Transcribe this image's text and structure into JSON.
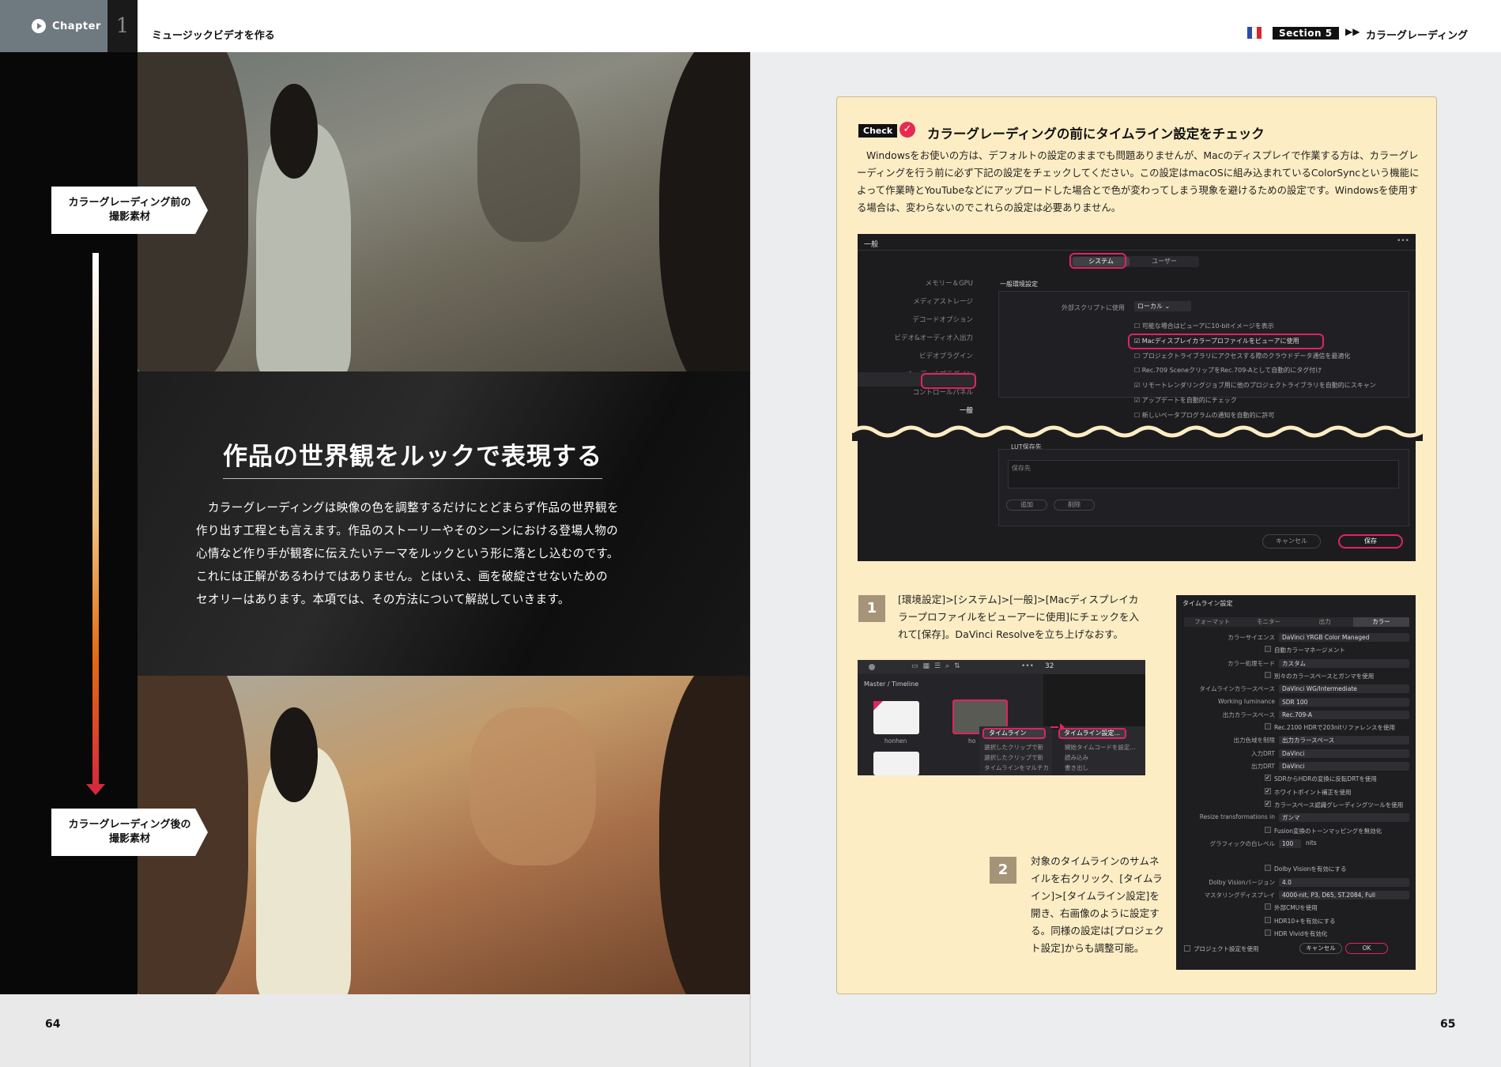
{
  "header": {
    "chapter_label": "Chapter",
    "chapter_number": "1",
    "chapter_title": "ミュージックビデオを作る",
    "section_badge": "Section 5",
    "section_arrows": "▶▶",
    "section_title": "カラーグレーディング",
    "flag_colors": [
      "#2b4da8",
      "#ffffff",
      "#d8262f"
    ]
  },
  "left": {
    "label_before_1": "カラーグレーディング前の",
    "label_before_2": "撮影素材",
    "label_after_1": "カラーグレーディング後の",
    "label_after_2": "撮影素材",
    "main_title": "作品の世界観をルックで表現する",
    "body": [
      "　カラーグレーディングは映像の色を調整するだけにとどまらず作品の世界観を",
      "作り出す工程とも言えます。作品のストーリーやそのシーンにおける登場人物の",
      "心情など作り手が観客に伝えたいテーマをルックという形に落とし込むのです。",
      "これには正解があるわけではありません。とはいえ、画を破綻させないための",
      "セオリーはあります。本項では、その方法について解説していきます。"
    ],
    "page_number": "64"
  },
  "right": {
    "check_tag": "Check",
    "check_mark": "✓",
    "check_title": "カラーグレーディングの前にタイムライン設定をチェック",
    "check_body": "Windowsをお使いの方は、デフォルトの設定のままでも問題ありませんが、Macのディスプレイで作業する方は、カラーグレーディングを行う前に必ず下記の設定をチェックしてください。この設定はmacOSに組み込まれているColorSyncという機能によって作業時とYouTubeなどにアップロードした場合とで色が変わってしまう現象を避けるための設定です。Windowsを使用する場合は、変わらないのでこれらの設定は必要ありません。",
    "shot1": {
      "title": "一般",
      "menu_dots": "•••",
      "tab_system": "システム",
      "tab_user": "ユーザー",
      "sidebar": [
        "メモリー＆GPU",
        "メディアストレージ",
        "デコードオプション",
        "ビデオ&オーディオ入出力",
        "ビデオプラグイン",
        "オーディオプラグイン",
        "コントロールパネル",
        "一般"
      ],
      "section_label": "一般環境設定",
      "script_label": "外部スクリプトに使用",
      "script_value": "ローカル",
      "options": [
        {
          "checked": false,
          "text": "可能な場合はビューアに10-bitイメージを表示"
        },
        {
          "checked": true,
          "text": "Macディスプレイカラープロファイルをビューアに使用"
        },
        {
          "checked": false,
          "text": "プロジェクトライブラリにアクセスする際のクラウドデータ通信を最適化"
        },
        {
          "checked": false,
          "text": "Rec.709 SceneクリップをRec.709-Aとして自動的にタグ付け"
        },
        {
          "checked": true,
          "text": "リモートレンダリングジョブ用に他のプロジェクトライブラリを自動的にスキャン"
        },
        {
          "checked": true,
          "text": "アップデートを自動的にチェック"
        },
        {
          "checked": false,
          "text": "新しいベータプログラムの通知を自動的に許可"
        }
      ],
      "lut_label": "LUT保存先",
      "save_to": "保存先",
      "add": "追加",
      "delete": "削除",
      "cancel": "キャンセル",
      "save": "保存"
    },
    "step1_num": "1",
    "step1_text": "[環境設定]>[システム]>[一般]>[Macディスプレイカラープロファイルをビューアーに使用]にチェックを入れて[保存]。DaVinci Resolveを立ち上げなおす。",
    "shot2": {
      "crumb": "Master / Timeline",
      "zoom": "32",
      "thumb1": "honhen",
      "thumb2": "ho",
      "menu_timeline": "タイムライン",
      "ctx": [
        "選択したクリップで新",
        "選択したクリップで新",
        "タイムラインをマルチカ"
      ],
      "sub": [
        "タイムライン設定...",
        "開始タイムコードを設定...",
        "読み込み",
        "書き出し"
      ]
    },
    "step2_num": "2",
    "step2_text": "対象のタイムラインのサムネイルを右クリック、[タイムライン]>[タイムライン設定]を開き、右画像のように設定する。同様の設定は[プロジェクト設定]からも調整可能。",
    "shot3": {
      "title": "タイムライン設定",
      "tabs": [
        "フォーマット",
        "モニター",
        "出力",
        "カラー"
      ],
      "rows": [
        {
          "label": "カラーサイエンス",
          "value": "DaVinci YRGB Color Managed"
        },
        {
          "check": false,
          "text": "自動カラーマネージメント"
        },
        {
          "label": "カラー処理モード",
          "value": "カスタム"
        },
        {
          "check": false,
          "text": "別々のカラースペースとガンマを使用"
        },
        {
          "label": "タイムラインカラースペース",
          "value": "DaVinci WG/Intermediate"
        },
        {
          "label": "Working luminance",
          "value": "SDR 100"
        },
        {
          "label": "出力カラースペース",
          "value": "Rec.709-A"
        },
        {
          "check": false,
          "text": "Rec.2100 HDRで203nitリファレンスを使用"
        },
        {
          "label": "出力色域を制限",
          "value": "出力カラースペース"
        },
        {
          "label": "入力DRT",
          "value": "DaVinci"
        },
        {
          "label": "出力DRT",
          "value": "DaVinci"
        },
        {
          "check": true,
          "text": "SDRからHDRの変換に反転DRTを使用"
        },
        {
          "check": true,
          "text": "ホワイトポイント補正を使用"
        },
        {
          "check": true,
          "text": "カラースペース認識グレーディングツールを使用"
        },
        {
          "label": "Resize transformations in",
          "value": "ガンマ"
        },
        {
          "check": false,
          "text": "Fusion変換のトーンマッピングを無効化"
        },
        {
          "label": "グラフィックの白レベル",
          "value": "100",
          "unit": "nits"
        },
        {
          "spacer": true
        },
        {
          "check": false,
          "text": "Dolby Visionを有効にする"
        },
        {
          "label": "Dolby Visionバージョン",
          "value": "4.0"
        },
        {
          "label": "マスタリングディスプレイ",
          "value": "4000-nit, P3, D65, ST.2084, Full"
        },
        {
          "check": false,
          "text": "外部CMUを使用"
        },
        {
          "check": false,
          "text": "HDR10+を有効にする"
        },
        {
          "check": false,
          "text": "HDR Vividを有効化"
        }
      ],
      "project_check": "プロジェクト設定を使用",
      "cancel": "キャンセル",
      "ok": "OK"
    },
    "page_number": "65",
    "accent_red": "#e0245e",
    "box_bg": "#fdedc4"
  }
}
